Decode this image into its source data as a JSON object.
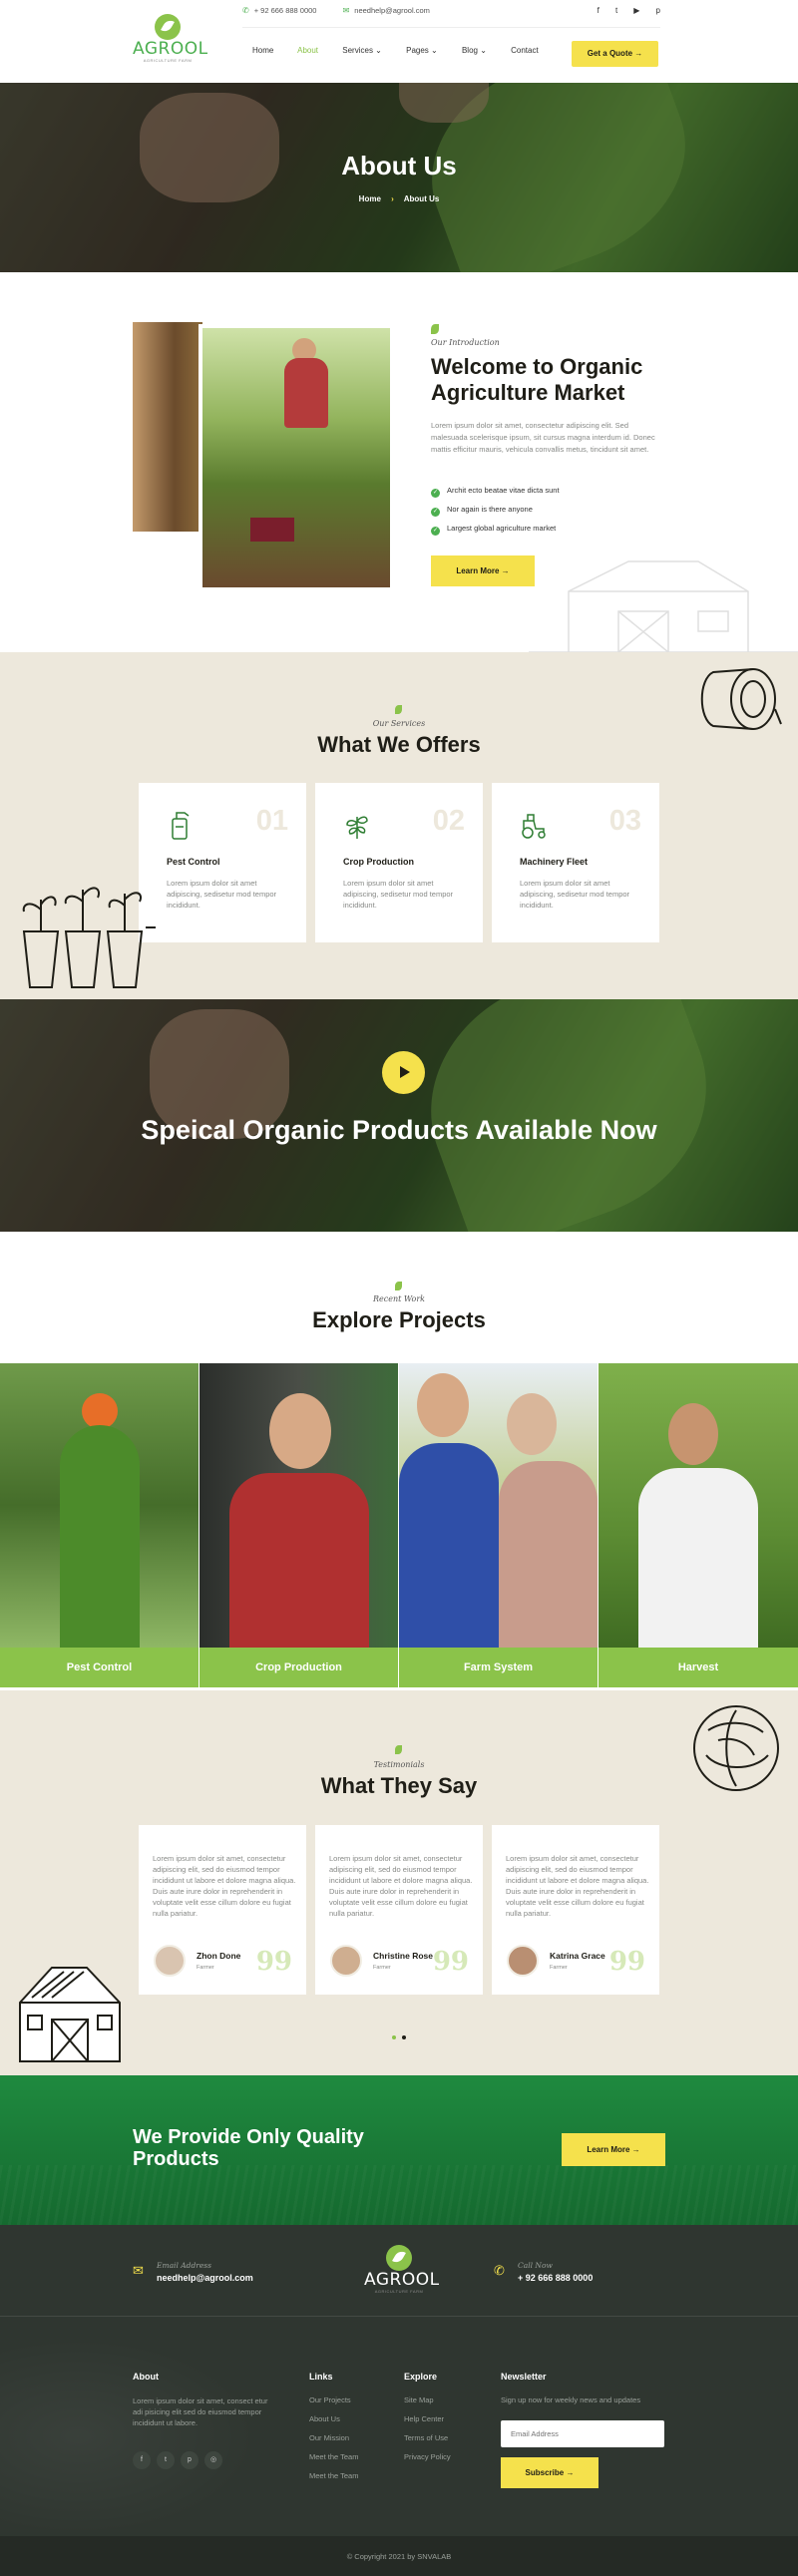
{
  "header": {
    "logo_text": "AGROOL",
    "logo_sub": "AGRICULTURE FARM",
    "phone": "+ 92 666 888 0000",
    "email": "needhelp@agrool.com",
    "socials": [
      "f",
      "t",
      "▶",
      "p"
    ],
    "nav": [
      {
        "label": "Home"
      },
      {
        "label": "About"
      },
      {
        "label": "Services ⌄"
      },
      {
        "label": "Pages ⌄"
      },
      {
        "label": "Blog ⌄"
      },
      {
        "label": "Contact"
      }
    ],
    "quote_btn": "Get a Quote →"
  },
  "page_hero": {
    "title": "About Us",
    "crumb_home": "Home",
    "crumb_sep": "›",
    "crumb_current": "About Us"
  },
  "about": {
    "tagline": "Our Introduction",
    "title": "Welcome to Organic Agriculture Market",
    "desc": "Lorem ipsum dolor sit amet, consectetur adipiscing elit. Sed malesuada scelerisque ipsum, sit cursus magna interdum id. Donec mattis efficitur mauris, vehicula convallis metus, tincidunt sit amet.",
    "points": [
      "Archit ecto beatae vitae dicta sunt",
      "Nor again is there anyone",
      "Largest global agriculture market"
    ],
    "button": "Learn More →"
  },
  "offers": {
    "tag": "Our Services",
    "title": "What We Offers",
    "cards": [
      {
        "num": "01",
        "title": "Pest Control",
        "desc": "Lorem ipsum dolor sit amet adipiscing, sedisetur mod tempor incididunt."
      },
      {
        "num": "02",
        "title": "Crop Production",
        "desc": "Lorem ipsum dolor sit amet adipiscing, sedisetur mod tempor incididunt."
      },
      {
        "num": "03",
        "title": "Machinery Fleet",
        "desc": "Lorem ipsum dolor sit amet adipiscing, sedisetur mod tempor incididunt."
      }
    ],
    "icons": [
      "spray-bottle-icon",
      "plant-icon",
      "tractor-icon"
    ]
  },
  "video": {
    "title": "Speical Organic Products Available Now"
  },
  "projects": {
    "tag": "Recent Work",
    "title": "Explore Projects",
    "items": [
      {
        "label": "Pest Control"
      },
      {
        "label": "Crop Production"
      },
      {
        "label": "Farm System"
      },
      {
        "label": "Harvest"
      }
    ]
  },
  "testimonials": {
    "tag": "Testimonials",
    "title": "What They Say",
    "items": [
      {
        "text": "Lorem ipsum dolor sit amet, consectetur adipiscing elit, sed do eiusmod tempor incididunt ut labore et dolore magna aliqua. Duis aute irure dolor in reprehenderit in voluptate velit esse cillum dolore eu fugiat nulla pariatur.",
        "name": "Zhon Done",
        "role": "Farmer"
      },
      {
        "text": "Lorem ipsum dolor sit amet, consectetur adipiscing elit, sed do eiusmod tempor incididunt ut labore et dolore magna aliqua. Duis aute irure dolor in reprehenderit in voluptate velit esse cillum dolore eu fugiat nulla pariatur.",
        "name": "Christine Rose",
        "role": "Farmer"
      },
      {
        "text": "Lorem ipsum dolor sit amet, consectetur adipiscing elit, sed do eiusmod tempor incididunt ut labore et dolore magna aliqua. Duis aute irure dolor in reprehenderit in voluptate velit esse cillum dolore eu fugiat nulla pariatur.",
        "name": "Katrina Grace",
        "role": "Farmer"
      }
    ],
    "quote_mark": "99"
  },
  "cta": {
    "title": "We Provide Only Quality Products",
    "button": "Learn More →"
  },
  "footer": {
    "email_label": "Email Address",
    "email": "needhelp@agrool.com",
    "phone_label": "Call Now",
    "phone": "+ 92 666 888 0000",
    "about_title": "About",
    "about_text": "Lorem ipsum dolor sit amet, consect etur adi pisicing elit sed do eiusmod tempor incididunt ut labore.",
    "socials": [
      "f",
      "t",
      "p",
      "◎"
    ],
    "links_title": "Links",
    "links": [
      "Our Projects",
      "About Us",
      "Our Mission",
      "Meet the Team",
      "Meet the Team"
    ],
    "explore_title": "Explore",
    "explore": [
      "Site Map",
      "Help Center",
      "Terms of Use",
      "Privacy Policy"
    ],
    "newsletter_title": "Newsletter",
    "newsletter_text": "Sign up now for weekly news and updates",
    "email_placeholder": "Email Address",
    "subscribe": "Subscribe →",
    "copyright": "© Copyright 2021 by SNVALAB"
  },
  "colors": {
    "accent_yellow": "#f5e14c",
    "brand_green": "#8bc34a",
    "dark_green": "#1f8a3f",
    "cream": "#ede8dc",
    "footer_dark": "#2f3630"
  }
}
